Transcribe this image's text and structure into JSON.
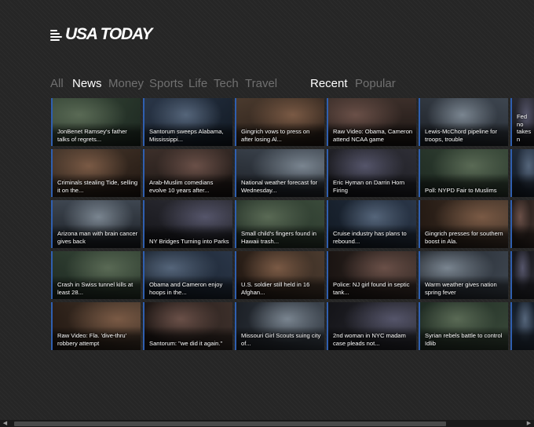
{
  "app": {
    "logo_text": "USA TODAY"
  },
  "sections": [
    "All",
    "News",
    "Money",
    "Sports",
    "Life",
    "Tech",
    "Travel"
  ],
  "active_section": "News",
  "sort_tabs": [
    "Recent",
    "Popular"
  ],
  "active_sort": "Recent",
  "tiles": [
    [
      "JonBenet Ramsey's father talks of regrets...",
      "Santorum sweeps Alabama, Mississippi...",
      "Gingrich vows to press on after losing Al...",
      "Raw Video: Obama, Cameron attend NCAA game",
      "Lewis-McChord pipeline for troops, trouble",
      "Fed no takes n"
    ],
    [
      "Criminals stealing Tide, selling it on the...",
      "Arab-Muslim comedians evolve 10 years after...",
      "National weather forecast for Wednesday...",
      "Eric Hyman on Darrin Horn Firing",
      "Poll: NYPD Fair to Muslims",
      ""
    ],
    [
      "Arizona man with brain cancer gives back",
      "NY Bridges Turning into Parks",
      "Small child's fingers found in Hawaii trash...",
      "Cruise industry has plans to rebound...",
      "Gingrich presses for southern boost in Ala.",
      ""
    ],
    [
      "Crash in Swiss tunnel kills at least 28...",
      "Obama and Cameron enjoy hoops in the...",
      "U.S. soldier still held in 16 Afghan...",
      "Police: NJ girl found in septic tank...",
      "Warm weather gives nation spring fever",
      ""
    ],
    [
      "Raw Video: Fla. 'dive-thru' robbery attempt",
      "Santorum: \"we did it again.\"",
      "Missouri Girl Scouts suing city of...",
      "2nd woman in NYC madam case pleads not...",
      "Syrian rebels battle to control Idlib",
      ""
    ]
  ],
  "scrollbar": {
    "left_arrow": "◀",
    "right_arrow": "▶"
  }
}
